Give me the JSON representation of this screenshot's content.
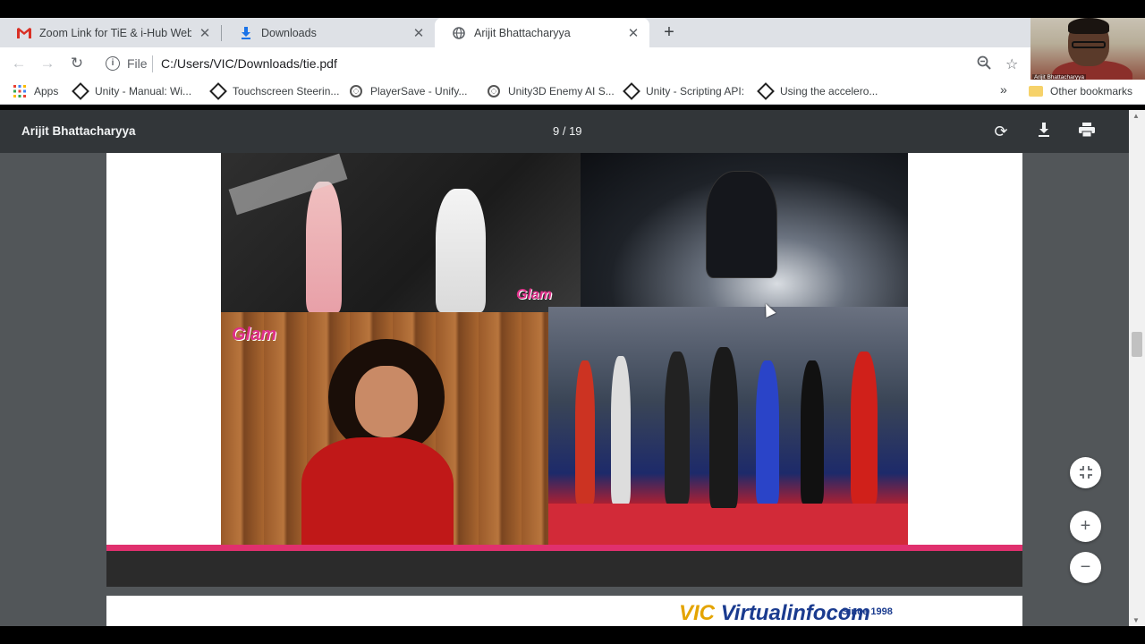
{
  "tabs": [
    {
      "label": "Zoom Link for TiE & i-Hub Webir",
      "icon": "gmail-icon"
    },
    {
      "label": "Downloads",
      "icon": "download-icon"
    },
    {
      "label": "Arijit Bhattacharyya",
      "icon": "globe-icon",
      "active": true
    }
  ],
  "toolbar": {
    "scheme": "File",
    "url": "C:/Users/VIC/Downloads/tie.pdf"
  },
  "bookmarks": {
    "apps": "Apps",
    "items": [
      {
        "label": "Unity - Manual: Wi...",
        "icon": "unity-icon"
      },
      {
        "label": "Touchscreen Steerin...",
        "icon": "unity-icon"
      },
      {
        "label": "PlayerSave - Unify...",
        "icon": "globe-icon"
      },
      {
        "label": "Unity3D Enemy AI S...",
        "icon": "globe-icon"
      },
      {
        "label": "Unity - Scripting API:",
        "icon": "unity-icon"
      },
      {
        "label": "Using the accelero...",
        "icon": "unity-icon"
      }
    ],
    "more": "»",
    "other": "Other bookmarks"
  },
  "webcam": {
    "name": "Arijit Bhattacharyya"
  },
  "pdf": {
    "title": "Arijit Bhattacharyya",
    "page_indicator": "9 / 19"
  },
  "page_content": {
    "watermark_1": "Glam",
    "watermark_2": "Glam",
    "logo_text": "Virtualinfocom",
    "logo_letter": "VIC",
    "since": "Since 1998"
  }
}
